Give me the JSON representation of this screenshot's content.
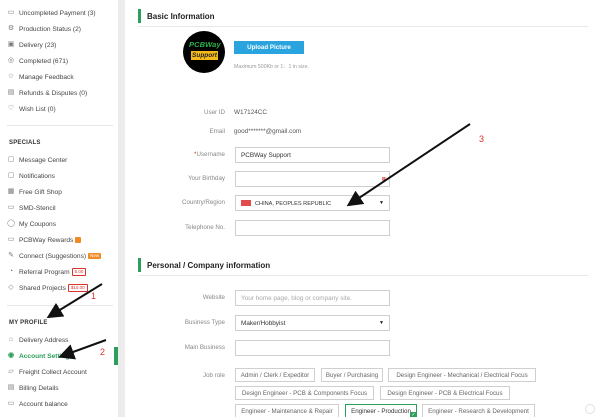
{
  "sidebar": {
    "orders": [
      {
        "label": "Uncompleted Payment (3)",
        "icon": "cart-icon"
      },
      {
        "label": "Production Status (2)",
        "icon": "gear-icon"
      },
      {
        "label": "Delivery (23)",
        "icon": "truck-icon"
      },
      {
        "label": "Completed (671)",
        "icon": "check-circle-icon"
      },
      {
        "label": "Manage Feedback",
        "icon": "star-icon"
      },
      {
        "label": "Refunds & Disputes (0)",
        "icon": "refund-icon"
      },
      {
        "label": "Wish List (0)",
        "icon": "heart-icon"
      }
    ],
    "specials_title": "SPECIALS",
    "specials": [
      {
        "label": "Message Center",
        "icon": "message-icon"
      },
      {
        "label": "Notifications",
        "icon": "bell-icon"
      },
      {
        "label": "Free Gift Shop",
        "icon": "gift-icon"
      },
      {
        "label": "SMD-Stencil",
        "icon": "stencil-icon"
      },
      {
        "label": "My Coupons",
        "icon": "coupon-icon"
      },
      {
        "label": "PCBWay Rewards",
        "icon": "reward-icon",
        "badge": ""
      },
      {
        "label": "Connect (Suggestions)",
        "icon": "connect-icon",
        "badge": "New"
      },
      {
        "label": "Referral Program",
        "icon": "referral-icon",
        "badge": "5.00"
      },
      {
        "label": "Shared Projects",
        "icon": "share-icon",
        "badge": "$10.00"
      }
    ],
    "profile_title": "MY PROFILE",
    "profile": [
      {
        "label": "Delivery Address",
        "icon": "location-icon"
      },
      {
        "label": "Account Settings",
        "icon": "user-icon",
        "active": true
      },
      {
        "label": "Freight Collect Account",
        "icon": "freight-icon"
      },
      {
        "label": "Billing Details",
        "icon": "billing-icon"
      },
      {
        "label": "Account balance",
        "icon": "wallet-icon"
      }
    ]
  },
  "basic": {
    "title": "Basic Information",
    "avatar_text_top": "PCBWay",
    "avatar_text_bottom": "Support",
    "upload_label": "Upload Picture",
    "upload_hint": "Maximum 500Kb or 1：1 in size.",
    "user_id_label": "User ID",
    "user_id": "W17124CC",
    "email_label": "Email",
    "email": "good*******@gmail.com",
    "username_label": "Username",
    "username": "PCBWay Support",
    "birthday_label": "Your Birthday",
    "birthday": "",
    "country_label": "Country/Region",
    "country": "CHINA, PEOPLES REPUBLIC",
    "telephone_label": "Telephone No.",
    "telephone": ""
  },
  "company": {
    "title": "Personal / Company information",
    "website_label": "Website",
    "website_placeholder": "Your home page, blog or company site.",
    "business_type_label": "Business Type",
    "business_type": "Maker/Hobbyist",
    "main_business_label": "Main Business",
    "main_business": "",
    "job_role_label": "Job role",
    "job_roles": [
      "Admin / Clerk / Expeditor",
      "Buyer / Purchasing",
      "Design Engineer - Mechanical / Electrical Focus",
      "Design Engineer - PCB & Components Focus",
      "Design Engineer - PCB & Electrical Focus",
      "Engineer - Maintenance & Repair",
      "Engineer - Production",
      "Engineer - Research & Development"
    ],
    "selected_job_role": "Engineer - Production"
  },
  "annotations": [
    "1",
    "2",
    "3"
  ],
  "colors": {
    "accent": "#2e9e5b",
    "upload": "#2aa4de",
    "annotation": "#d9342b"
  }
}
